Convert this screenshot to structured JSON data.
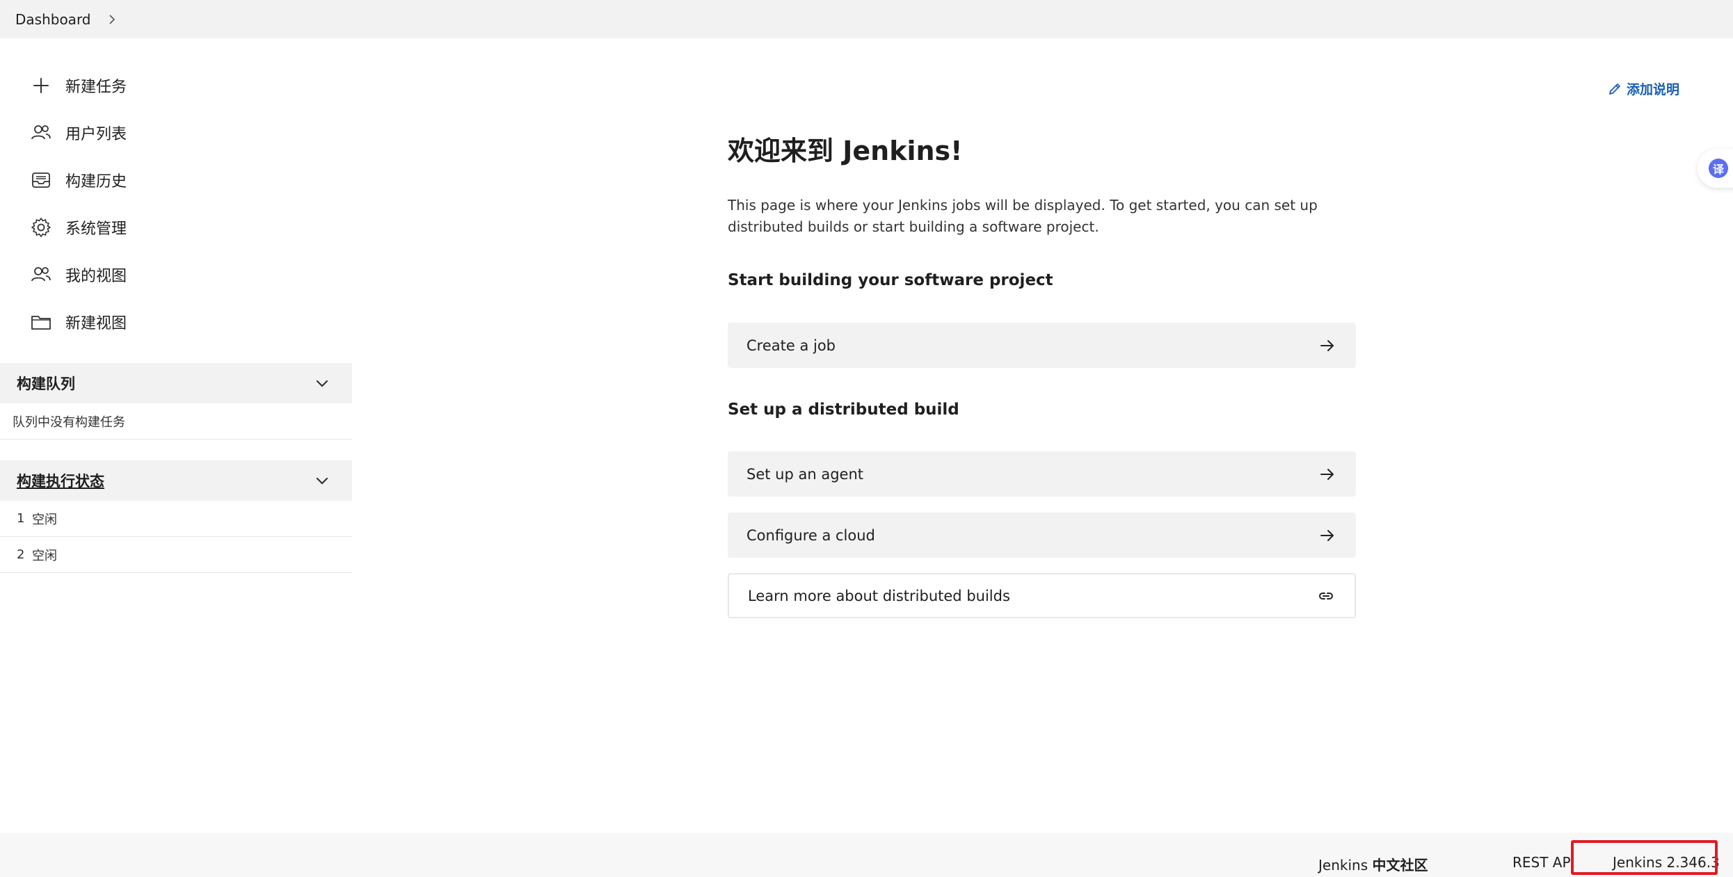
{
  "breadcrumb": {
    "items": [
      "Dashboard"
    ]
  },
  "sidebar": {
    "tasks": [
      {
        "label": "新建任务",
        "icon": "plus-icon"
      },
      {
        "label": "用户列表",
        "icon": "people-icon"
      },
      {
        "label": "构建历史",
        "icon": "inbox-icon"
      },
      {
        "label": "系统管理",
        "icon": "gear-icon"
      },
      {
        "label": "我的视图",
        "icon": "people-icon"
      },
      {
        "label": "新建视图",
        "icon": "folder-icon"
      }
    ],
    "build_queue": {
      "title": "构建队列",
      "empty_text": "队列中没有构建任务"
    },
    "executors": {
      "title": "构建执行状态",
      "items": [
        {
          "number": "1",
          "status": "空闲"
        },
        {
          "number": "2",
          "status": "空闲"
        }
      ]
    }
  },
  "main": {
    "add_description": "添加说明",
    "welcome_title": "欢迎来到 Jenkins!",
    "intro": "This page is where your Jenkins jobs will be displayed. To get started, you can set up distributed builds or start building a software project.",
    "start_heading": "Start building your software project",
    "create_job": "Create a job",
    "distributed_heading": "Set up a distributed build",
    "setup_agent": "Set up an agent",
    "configure_cloud": "Configure a cloud",
    "learn_more": "Learn more about distributed builds"
  },
  "translate_widget": {
    "glyph": "译"
  },
  "footer": {
    "community_prefix": "Jenkins",
    "community_suffix": "中文社区",
    "rest_api": "REST API",
    "version": "Jenkins 2.346.3"
  },
  "colors": {
    "accent_link": "#1a5fb4",
    "highlight_box": "#e01b24",
    "panel_bg": "#f2f2f2"
  }
}
